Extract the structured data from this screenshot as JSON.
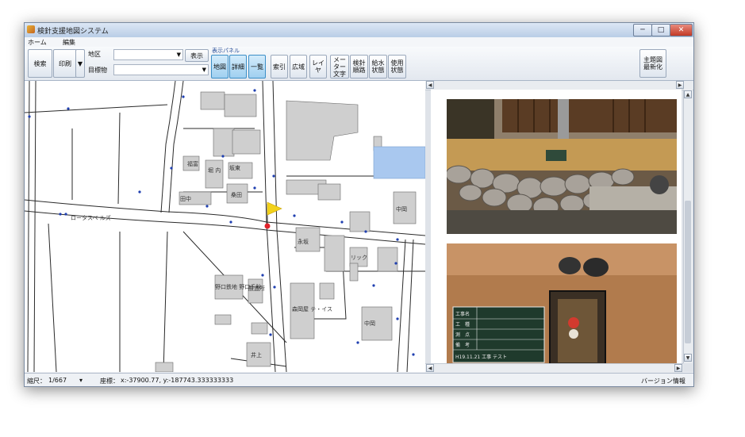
{
  "window": {
    "title": "検針支援地図システム",
    "controls": [
      "─",
      "□",
      "✕"
    ]
  },
  "menu": {
    "items": [
      "ホーム",
      "編集"
    ]
  },
  "toolbar": {
    "search": "検索",
    "print": "印刷",
    "print_dropdown": "▼",
    "area_label": "地区",
    "landmark_label": "目標物",
    "area_value": "",
    "landmark_value": "",
    "display_button": "表示",
    "panel_title": "表示パネル",
    "panel_buttons": [
      "地図",
      "詳細",
      "一覧"
    ],
    "tools": [
      "索引",
      "広域",
      "レイ\nヤ",
      "メーター\n文字",
      "検針\n順路",
      "給水\n状態",
      "使用\n状態"
    ],
    "refresh": "主題図\n最新化"
  },
  "map": {
    "labels": [
      "坂東",
      "桑田",
      "堀\n内",
      "福富",
      "田中",
      "中岡",
      "永坂",
      "リック",
      "野口鉄地\n野口千秋",
      "酸造所",
      "森岡屋\nテ・イス",
      "井上",
      "中岡",
      "ロータスベ\nルズ"
    ],
    "marker": {
      "color": "#e0222a",
      "flag_color": "#f2d21b"
    },
    "colors": {
      "road": "#2a2a2a",
      "building": "#cfcfcf",
      "pool": "#a9c8ef",
      "meter_dot": "#1f3fb0"
    }
  },
  "photo_panel": {
    "photo1": "stone-wall-garden",
    "photo2_board": {
      "rows": [
        "工事名",
        "工　種",
        "測　点",
        "備　考"
      ],
      "bottom": "H19.11.21 工事 テスト"
    }
  },
  "status": {
    "scale_label": "縮尺：",
    "scale_value": "1/667",
    "scale_dropdown": "▾",
    "coord_label": "座標：",
    "coord_value": "x:-37900.77, y:-187743.333333333",
    "version": "バージョン情報"
  }
}
